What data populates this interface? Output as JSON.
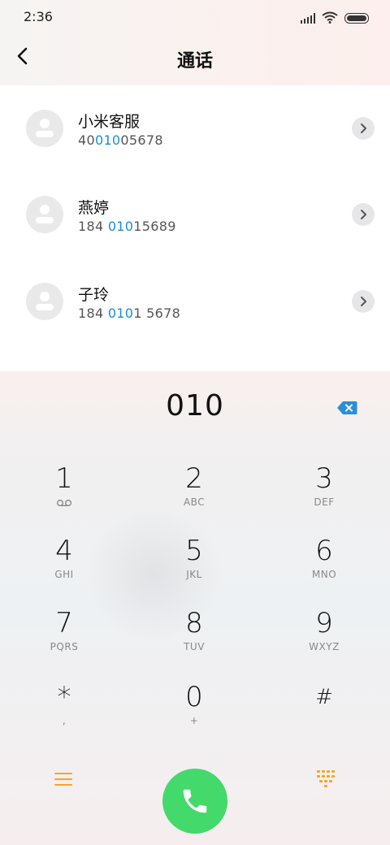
{
  "status_bar": {
    "time": "2:36"
  },
  "header": {
    "title": "通话"
  },
  "contacts": [
    {
      "name": "小米客服",
      "number_pre": "40",
      "number_match": "010",
      "number_post": "05678"
    },
    {
      "name": "燕婷",
      "number_pre": "184 ",
      "number_match": "010",
      "number_post": "15689"
    },
    {
      "name": "子玲",
      "number_pre": "184 ",
      "number_match": "010",
      "number_post": "1 5678"
    }
  ],
  "dialer": {
    "input": "010",
    "keys": [
      {
        "digit": "1",
        "letters": ""
      },
      {
        "digit": "2",
        "letters": "ABC"
      },
      {
        "digit": "3",
        "letters": "DEF"
      },
      {
        "digit": "4",
        "letters": "GHI"
      },
      {
        "digit": "5",
        "letters": "JKL"
      },
      {
        "digit": "6",
        "letters": "MNO"
      },
      {
        "digit": "7",
        "letters": "PQRS"
      },
      {
        "digit": "8",
        "letters": "TUV"
      },
      {
        "digit": "9",
        "letters": "WXYZ"
      },
      {
        "digit": "*",
        "letters": ","
      },
      {
        "digit": "0",
        "letters": "+"
      },
      {
        "digit": "#",
        "letters": ""
      }
    ]
  },
  "colors": {
    "highlight": "#1a8fd4",
    "call": "#43d96b",
    "accent": "#f5a623"
  },
  "icons": [
    "back-arrow-icon",
    "chevron-right-icon",
    "voicemail-icon",
    "backspace-icon",
    "menu-icon",
    "phone-icon",
    "dialpad-icon",
    "signal-icon",
    "wifi-icon",
    "battery-icon"
  ]
}
